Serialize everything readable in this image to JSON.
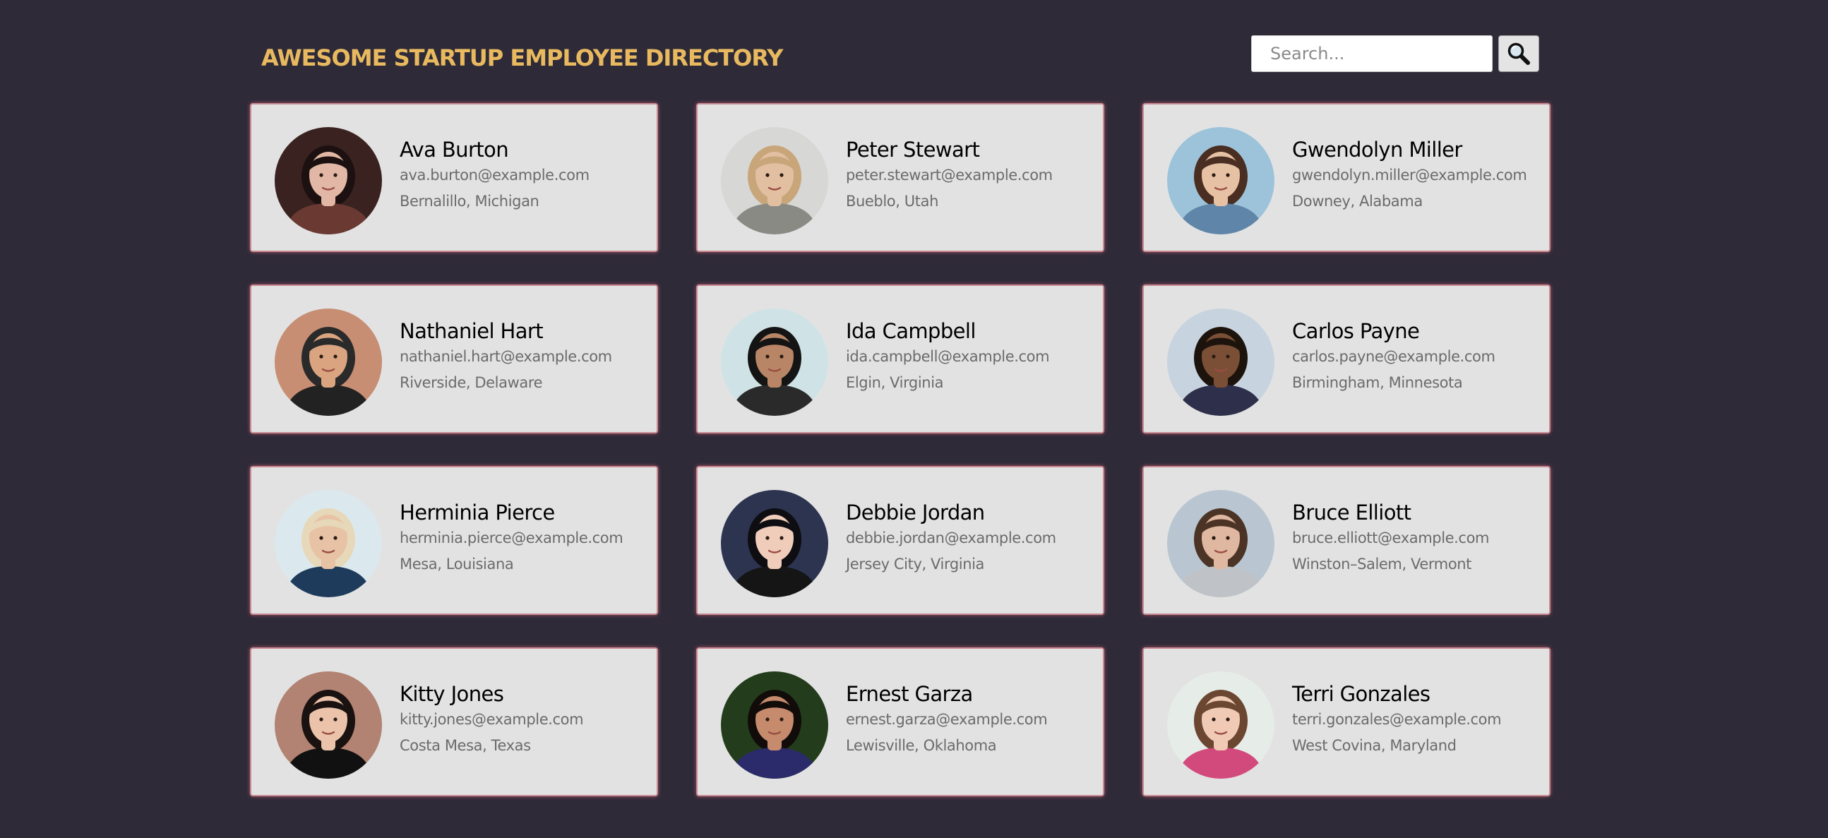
{
  "header": {
    "title": "AWESOME STARTUP EMPLOYEE DIRECTORY",
    "search_placeholder": "Search...",
    "search_icon": "magnifier-icon"
  },
  "colors": {
    "background": "#2e2a38",
    "title": "#e8b95f",
    "card_background": "#e2e2e2",
    "card_border": "#c98a92"
  },
  "employees": [
    {
      "name": "Ava Burton",
      "email": "ava.burton@example.com",
      "location": "Bernalillo, Michigan",
      "avatar": {
        "bg": "#3a2220",
        "skin": "#e2b7a5",
        "hair": "#1c1110",
        "shirt": "#6a3a32",
        "shirt_style": "dark"
      }
    },
    {
      "name": "Peter Stewart",
      "email": "peter.stewart@example.com",
      "location": "Bueblo, Utah",
      "avatar": {
        "bg": "#d7d7d6",
        "skin": "#e3bfa2",
        "hair": "#c8a67a",
        "shirt": "#8a8a84",
        "shirt_style": "light"
      }
    },
    {
      "name": "Gwendolyn Miller",
      "email": "gwendolyn.miller@example.com",
      "location": "Downey, Alabama",
      "avatar": {
        "bg": "#9cc3da",
        "skin": "#e7c1a4",
        "hair": "#4a2e22",
        "shirt": "#5f86a8",
        "shirt_style": "light"
      }
    },
    {
      "name": "Nathaniel Hart",
      "email": "nathaniel.hart@example.com",
      "location": "Riverside, Delaware",
      "avatar": {
        "bg": "#c78e73",
        "skin": "#d9a47f",
        "hair": "#2a2a2a",
        "shirt": "#222222",
        "shirt_style": "dark"
      }
    },
    {
      "name": "Ida Campbell",
      "email": "ida.campbell@example.com",
      "location": "Elgin, Virginia",
      "avatar": {
        "bg": "#cfe3e6",
        "skin": "#b88666",
        "hair": "#141414",
        "shirt": "#2a2a2a",
        "shirt_style": "dark"
      }
    },
    {
      "name": "Carlos Payne",
      "email": "carlos.payne@example.com",
      "location": "Birmingham, Minnesota",
      "avatar": {
        "bg": "#c7d3df",
        "skin": "#7a4f35",
        "hair": "#1d130d",
        "shirt": "#2e2f4a",
        "shirt_style": "dark"
      }
    },
    {
      "name": "Herminia Pierce",
      "email": "herminia.pierce@example.com",
      "location": "Mesa, Louisiana",
      "avatar": {
        "bg": "#dbe9ee",
        "skin": "#e8c2a5",
        "hair": "#e6d8b8",
        "shirt": "#1f3b5c",
        "shirt_style": "dark"
      }
    },
    {
      "name": "Debbie Jordan",
      "email": "debbie.jordan@example.com",
      "location": "Jersey City, Virginia",
      "avatar": {
        "bg": "#2c3450",
        "skin": "#f0cdbb",
        "hair": "#0d0d12",
        "shirt": "#151515",
        "shirt_style": "dark"
      }
    },
    {
      "name": "Bruce Elliott",
      "email": "bruce.elliott@example.com",
      "location": "Winston–Salem, Vermont",
      "avatar": {
        "bg": "#b9c6d1",
        "skin": "#e0b7a0",
        "hair": "#4b3426",
        "shirt": "#bfc2c6",
        "shirt_style": "light"
      }
    },
    {
      "name": "Kitty Jones",
      "email": "kitty.jones@example.com",
      "location": "Costa Mesa, Texas",
      "avatar": {
        "bg": "#b28272",
        "skin": "#eac3aa",
        "hair": "#1a1210",
        "shirt": "#111111",
        "shirt_style": "dark"
      }
    },
    {
      "name": "Ernest Garza",
      "email": "ernest.garza@example.com",
      "location": "Lewisville, Oklahoma",
      "avatar": {
        "bg": "#233d1c",
        "skin": "#c68a6c",
        "hair": "#110c0a",
        "shirt": "#2b2a6a",
        "shirt_style": "dark"
      }
    },
    {
      "name": "Terri Gonzales",
      "email": "terri.gonzales@example.com",
      "location": "West Covina, Maryland",
      "avatar": {
        "bg": "#e6ece8",
        "skin": "#f0cab5",
        "hair": "#6b4630",
        "shirt": "#d24a7c",
        "shirt_style": "light"
      }
    }
  ]
}
